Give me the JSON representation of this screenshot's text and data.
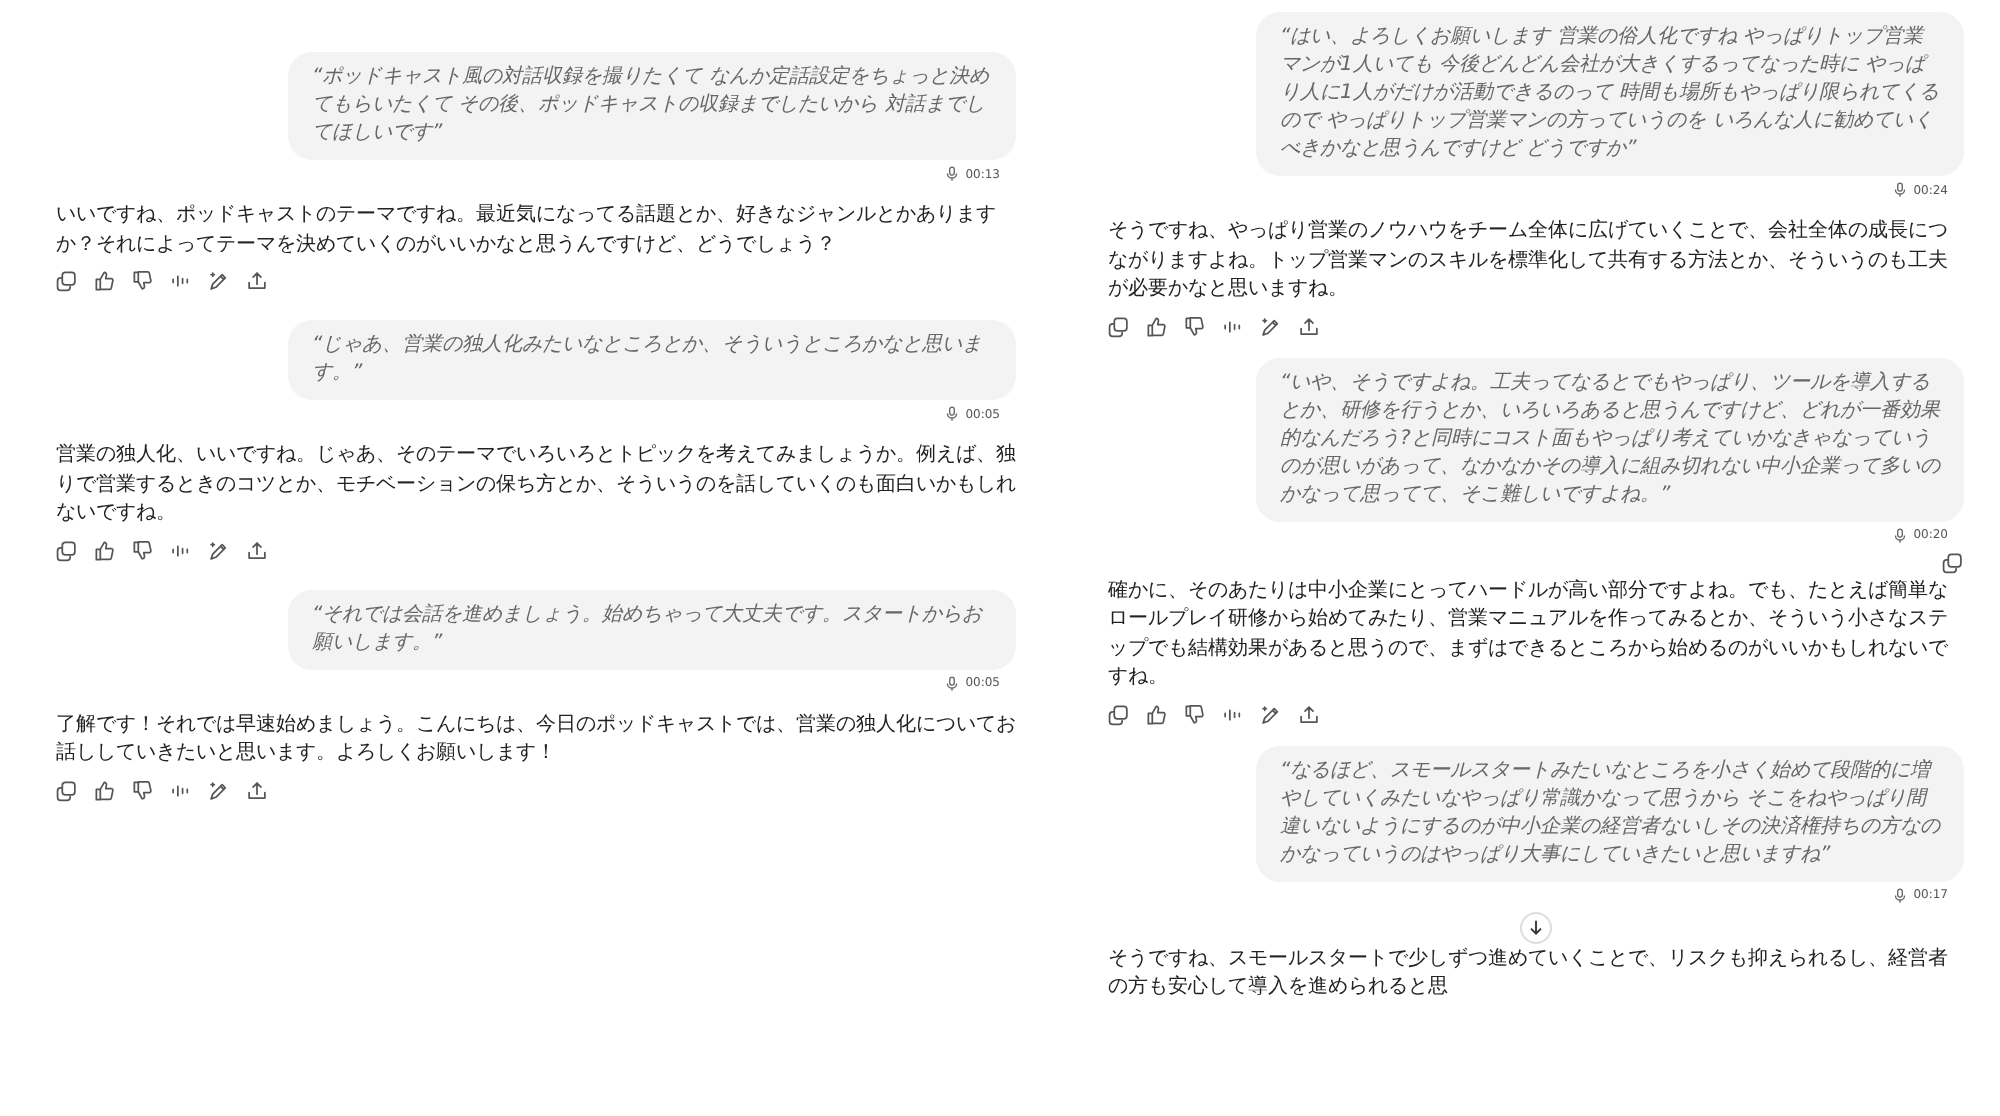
{
  "columns": [
    {
      "messages": [
        {
          "kind": "user",
          "text": "“ポッドキャスト風の対話収録を撮りたくて なんか定話設定をちょっと決めてもらいたくて その後、ポッドキャストの収録までしたいから 対話までしてほしいです”",
          "duration": "00:13"
        },
        {
          "kind": "assistant",
          "text": "いいですね、ポッドキャストのテーマですね。最近気になってる話題とか、好きなジャンルとかありますか？それによってテーマを決めていくのがいいかなと思うんですけど、どうでしょう？"
        },
        {
          "kind": "action_bar"
        },
        {
          "kind": "user",
          "text": "“じゃあ、営業の独人化みたいなところとか、そういうところかなと思います。”",
          "duration": "00:05"
        },
        {
          "kind": "assistant",
          "text": "営業の独人化、いいですね。じゃあ、そのテーマでいろいろとトピックを考えてみましょうか。例えば、独りで営業するときのコツとか、モチベーションの保ち方とか、そういうのを話していくのも面白いかもしれないですね。"
        },
        {
          "kind": "action_bar"
        },
        {
          "kind": "user",
          "text": "“それでは会話を進めましょう。始めちゃって大丈夫です。スタートからお願いします。”",
          "duration": "00:05"
        },
        {
          "kind": "assistant",
          "text": "了解です！それでは早速始めましょう。こんにちは、今日のポッドキャストでは、営業の独人化についてお話ししていきたいと思います。よろしくお願いします！"
        },
        {
          "kind": "action_bar"
        }
      ]
    },
    {
      "messages": [
        {
          "kind": "user",
          "text": "“はい、よろしくお願いします 営業の俗人化ですね やっぱりトップ営業マンが1人いても 今後どんどん会社が大きくするってなった時に やっぱり人に1人がだけが活動できるのって 時間も場所もやっぱり限られてくるので やっぱりトップ営業マンの方っていうのを いろんな人に勧めていくべきかなと思うんですけど どうですか”",
          "duration": "00:24"
        },
        {
          "kind": "assistant",
          "text": "そうですね、やっぱり営業のノウハウをチーム全体に広げていくことで、会社全体の成長につながりますよね。トップ営業マンのスキルを標準化して共有する方法とか、そういうのも工夫が必要かなと思いますね。"
        },
        {
          "kind": "action_bar"
        },
        {
          "kind": "user",
          "text": "“いや、そうですよね。工夫ってなるとでもやっぱり、ツールを導入するとか、研修を行うとか、いろいろあると思うんですけど、どれが一番効果的なんだろう?と同時にコスト面もやっぱり考えていかなきゃなっていうのが思いがあって、なかなかその導入に組み切れない中小企業って多いのかなって思ってて、そこ難しいですよね。”",
          "duration": "00:20"
        },
        {
          "kind": "copy_button"
        },
        {
          "kind": "assistant",
          "text": "確かに、そのあたりは中小企業にとってハードルが高い部分ですよね。でも、たとえば簡単なロールプレイ研修から始めてみたり、営業マニュアルを作ってみるとか、そういう小さなステップでも結構効果があると思うので、まずはできるところから始めるのがいいかもしれないですね。"
        },
        {
          "kind": "action_bar"
        },
        {
          "kind": "user",
          "text": "“なるほど、スモールスタートみたいなところを小さく始めて段階的に増やしていくみたいなやっぱり常識かなって思うから そこをねやっぱり間違いないようにするのが中小企業の経営者ないしその決済権持ちの方なのかなっていうのはやっぱり大事にしていきたいと思いますね”",
          "duration": "00:17"
        },
        {
          "kind": "scroll_button"
        },
        {
          "kind": "assistant",
          "text": "そうですね、スモールスタートで少しずつ進めていくことで、リスクも抑えられるし、経営者の方も安心して導入を進められると思"
        }
      ]
    }
  ]
}
